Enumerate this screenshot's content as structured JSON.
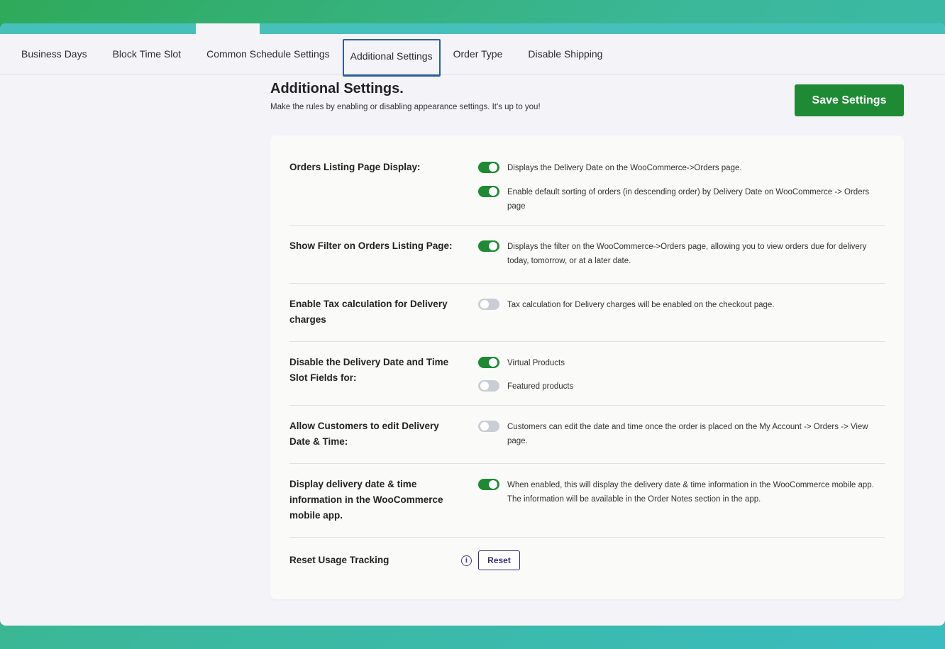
{
  "tabs": [
    {
      "label": "Business Days"
    },
    {
      "label": "Block Time Slot"
    },
    {
      "label": "Common Schedule Settings"
    },
    {
      "label": "Additional Settings",
      "active": true
    },
    {
      "label": "Order Type"
    },
    {
      "label": "Disable Shipping"
    }
  ],
  "header": {
    "title": "Additional Settings.",
    "subtitle": "Make the rules by enabling or disabling appearance settings. It's up to you!",
    "save_label": "Save Settings"
  },
  "settings": [
    {
      "label": "Orders Listing Page Display:",
      "options": [
        {
          "enabled": true,
          "text": "Displays the Delivery Date on the WooCommerce->Orders page."
        },
        {
          "enabled": true,
          "text": "Enable default sorting of orders (in descending order) by Delivery Date on WooCommerce -> Orders page"
        }
      ]
    },
    {
      "label": "Show Filter on Orders Listing Page:",
      "options": [
        {
          "enabled": true,
          "text": "Displays the filter on the WooCommerce->Orders page, allowing you to view orders due for delivery today, tomorrow, or at a later date."
        }
      ]
    },
    {
      "label": "Enable Tax calculation for Delivery charges",
      "options": [
        {
          "enabled": false,
          "text": "Tax calculation for Delivery charges will be enabled on the checkout page."
        }
      ]
    },
    {
      "label": "Disable the Delivery Date and Time Slot Fields for:",
      "options": [
        {
          "enabled": true,
          "text": "Virtual Products"
        },
        {
          "enabled": false,
          "text": "Featured products"
        }
      ]
    },
    {
      "label": "Allow Customers to edit Delivery Date & Time:",
      "options": [
        {
          "enabled": false,
          "text": "Customers can edit the date and time once the order is placed on the My Account -> Orders -> View page."
        }
      ]
    },
    {
      "label": "Display delivery date & time information in the WooCommerce mobile app.",
      "options": [
        {
          "enabled": true,
          "text": "When enabled, this will display the delivery date & time information in the WooCommerce mobile app. The information will be available in the Order Notes section in the app."
        }
      ]
    }
  ],
  "reset": {
    "label": "Reset Usage Tracking",
    "info_icon": "info-icon",
    "info_glyph": "i",
    "button_label": "Reset"
  },
  "colors": {
    "accent_green": "#1e8a34",
    "toggle_off": "#c8cdd6",
    "active_tab_border": "#2b5f9e",
    "reset_purple": "#3c2a78"
  }
}
